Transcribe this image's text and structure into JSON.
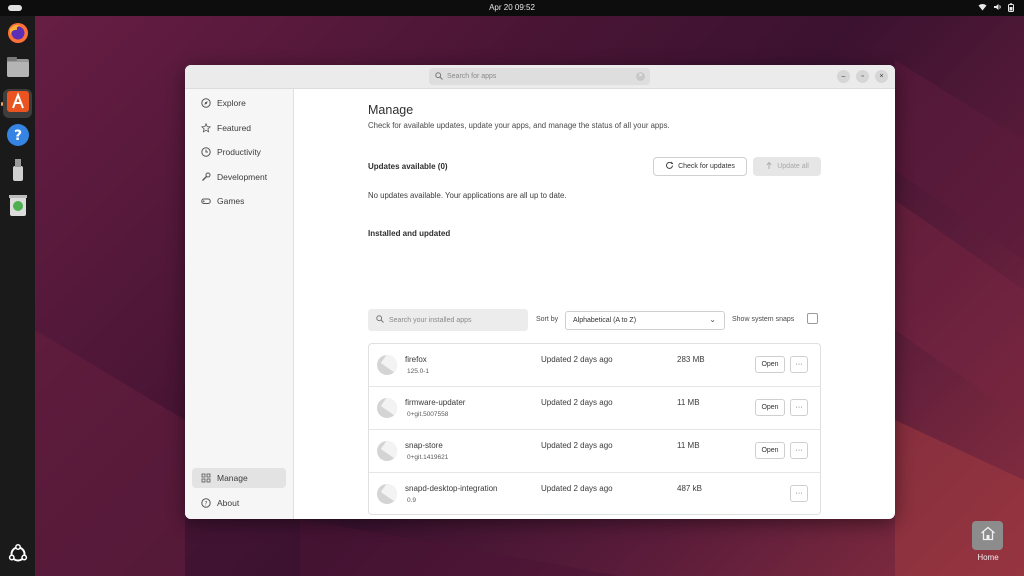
{
  "topbar": {
    "clock": "Apr 20  09:52",
    "icons": [
      "wifi-icon",
      "volume-icon",
      "battery-icon"
    ]
  },
  "dock": {
    "items": [
      "firefox-icon",
      "files-icon",
      "app-center-icon",
      "help-icon",
      "usb-drive-icon",
      "trash-icon"
    ],
    "bottom_icon": "ubuntu-logo-icon"
  },
  "window": {
    "search_placeholder": "Search for apps",
    "controls": [
      "minimize",
      "maximize",
      "close"
    ]
  },
  "sidebar": {
    "items": [
      {
        "label": "Explore",
        "icon": "compass-icon"
      },
      {
        "label": "Featured",
        "icon": "star-icon"
      },
      {
        "label": "Productivity",
        "icon": "clock-icon"
      },
      {
        "label": "Development",
        "icon": "wrench-icon"
      },
      {
        "label": "Games",
        "icon": "gamepad-icon"
      }
    ],
    "bottom_items": [
      {
        "label": "Manage",
        "icon": "grid-icon",
        "selected": true
      },
      {
        "label": "About",
        "icon": "question-icon"
      }
    ]
  },
  "manage": {
    "title": "Manage",
    "subtitle": "Check for available updates, update your apps, and manage the status of all your apps.",
    "updates_title": "Updates available (0)",
    "check_updates_label": "Check for updates",
    "update_all_label": "Update all",
    "no_updates_text": "No updates available. Your applications are all up to date.",
    "installed_title": "Installed and updated",
    "installed_search_placeholder": "Search your installed apps",
    "sort_by_label": "Sort by",
    "sort_value": "Alphabetical (A to Z)",
    "system_snaps_label": "Show system snaps",
    "system_snaps_checked": false
  },
  "apps": [
    {
      "name": "firefox",
      "version": "125.0-1",
      "updated": "Updated 2 days ago",
      "size": "283 MB",
      "open_label": "Open",
      "more_label": "···"
    },
    {
      "name": "firmware-updater",
      "version": "0+git.5007558",
      "updated": "Updated 2 days ago",
      "size": "11 MB",
      "open_label": "Open",
      "more_label": "···"
    },
    {
      "name": "snap-store",
      "version": "0+git.1419621",
      "updated": "Updated 2 days ago",
      "size": "11 MB",
      "open_label": "Open",
      "more_label": "···"
    },
    {
      "name": "snapd-desktop-integration",
      "version": "0.9",
      "updated": "Updated 2 days ago",
      "size": "487 kB",
      "open_label": "",
      "more_label": "···"
    }
  ],
  "desktop": {
    "home_label": "Home"
  }
}
